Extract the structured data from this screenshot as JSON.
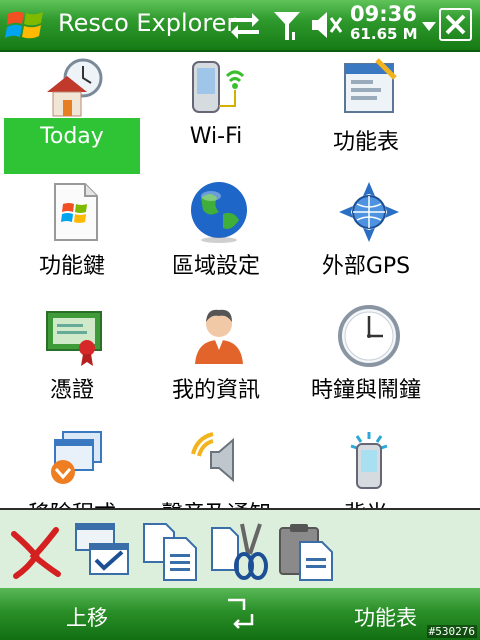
{
  "titlebar": {
    "title": "Resco Explorer",
    "time": "09:36",
    "memory": "61.65 M",
    "icons": [
      "windows-start-icon",
      "sync-arrows-icon",
      "signal-antenna-icon",
      "volume-icon",
      "close-icon"
    ]
  },
  "grid": {
    "items": [
      {
        "label": "Today",
        "icon": "today-house-clock-icon",
        "selected": true
      },
      {
        "label": "Wi-Fi",
        "icon": "wifi-device-icon",
        "selected": false
      },
      {
        "label": "功能表",
        "icon": "menu-folder-icon",
        "selected": false
      },
      {
        "label": "功能鍵",
        "icon": "buttons-document-icon",
        "selected": false
      },
      {
        "label": "區域設定",
        "icon": "globe-icon",
        "selected": false
      },
      {
        "label": "外部GPS",
        "icon": "gps-satellite-icon",
        "selected": false
      },
      {
        "label": "憑證",
        "icon": "certificate-icon",
        "selected": false
      },
      {
        "label": "我的資訊",
        "icon": "owner-person-icon",
        "selected": false
      },
      {
        "label": "時鐘與鬧鐘",
        "icon": "clock-icon",
        "selected": false
      },
      {
        "label": "移除程式",
        "icon": "remove-programs-icon",
        "selected": false
      },
      {
        "label": "聲音及通知",
        "icon": "sound-speaker-icon",
        "selected": false
      },
      {
        "label": "背光",
        "icon": "backlight-device-icon",
        "selected": false
      }
    ]
  },
  "toolbar": {
    "tools": [
      "delete-x-icon",
      "select-windows-icon",
      "copy-icon",
      "cut-scissors-icon",
      "paste-clipboard-icon"
    ]
  },
  "softkeys": {
    "left": "上移",
    "right": "功能表"
  },
  "watermark": "#530276",
  "colors": {
    "accent": "#2f9a2d",
    "selection": "#2fc436",
    "toolbar_bg": "#dcefdc"
  }
}
